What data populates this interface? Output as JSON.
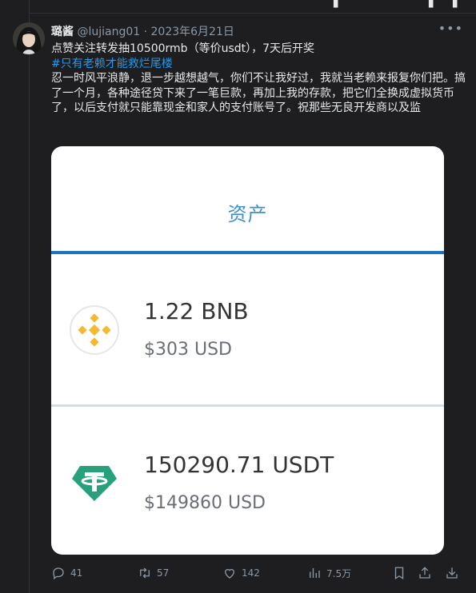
{
  "tweet": {
    "display_name": "璐酱",
    "handle": "@lujiang01",
    "separator": "·",
    "date": "2023年6月21日",
    "more_icon": "more-horizontal-icon",
    "lines": {
      "line1": "点赞关注转发抽10500rmb（等价usdt），7天后开奖",
      "hashtag": "#只有老赖才能救烂尾楼",
      "body": "忍一时风平浪静，退一步越想越气，你们不让我好过，我就当老赖来报复你们把。搞了一个月，各种途径贷下来了一笔巨款，再加上我的存款，把它们全换成虚拟货币了，以后支付就只能靠现金和家人的支付账号了。祝那些无良开发商以及监"
    }
  },
  "media": {
    "title": "资产",
    "assets": [
      {
        "amount": "1.22 BNB",
        "value": "$303 USD",
        "icon": "bnb-coin-icon"
      },
      {
        "amount": "150290.71 USDT",
        "value": "$149860 USD",
        "icon": "tether-coin-icon"
      }
    ],
    "colors": {
      "title": "#3a8fd0",
      "rule": "#1b74c4",
      "bnb": "#f3ba2f",
      "tether": "#26a17b"
    }
  },
  "actions": {
    "reply": {
      "icon": "reply-icon",
      "count": "41"
    },
    "retweet": {
      "icon": "retweet-icon",
      "count": "57"
    },
    "like": {
      "icon": "heart-icon",
      "count": "142"
    },
    "views": {
      "icon": "views-icon",
      "count": "7.5万"
    },
    "bookmark": {
      "icon": "bookmark-icon"
    },
    "share": {
      "icon": "share-icon"
    },
    "download": {
      "icon": "download-icon"
    }
  }
}
